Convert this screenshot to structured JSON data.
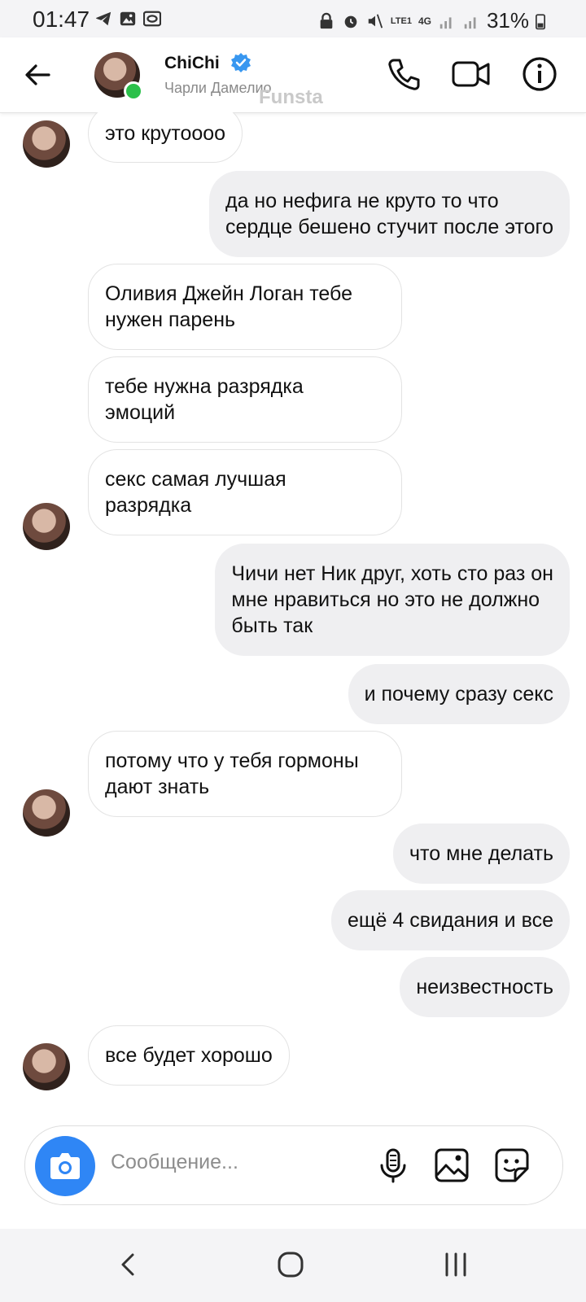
{
  "status_bar": {
    "time": "01:47",
    "battery": "31%",
    "network": "4G",
    "lte": "LTE1"
  },
  "header": {
    "name": "ChiChi",
    "subtitle": "Чарли Дамелио",
    "watermark": "Funsta"
  },
  "messages": [
    {
      "side": "in",
      "text": "это крутоооо"
    },
    {
      "side": "out",
      "text": "да но нефига не круто то что\nсердце бешено стучит после этого"
    },
    {
      "side": "in",
      "text": "Оливия Джейн Логан тебе\nнужен парень"
    },
    {
      "side": "in",
      "text": "тебе нужна разрядка\nэмоций"
    },
    {
      "side": "in",
      "text": "секс самая лучшая\nразрядка"
    },
    {
      "side": "out",
      "text": "Чичи нет Ник друг, хоть сто раз он\nмне нравиться но это не должно\nбыть так"
    },
    {
      "side": "out",
      "text": "и почему сразу секс"
    },
    {
      "side": "in",
      "text": "потому что у тебя гормоны\nдают знать"
    },
    {
      "side": "out",
      "text": "что мне делать"
    },
    {
      "side": "out",
      "text": "ещё 4 свидания и все"
    },
    {
      "side": "out",
      "text": "неизвестность"
    },
    {
      "side": "in",
      "text": "все будет хорошо"
    }
  ],
  "composer": {
    "placeholder": "Сообщение..."
  },
  "colors": {
    "accent": "#2f86f5",
    "verified": "#3897f0",
    "online": "#2bc04a",
    "outgoing_bubble": "#efeff1"
  },
  "icons": [
    "back-arrow-icon",
    "verified-badge-icon",
    "phone-icon",
    "video-camera-icon",
    "info-icon",
    "camera-icon",
    "microphone-icon",
    "gallery-icon",
    "sticker-icon",
    "nav-back-icon",
    "nav-home-icon",
    "nav-recents-icon"
  ]
}
